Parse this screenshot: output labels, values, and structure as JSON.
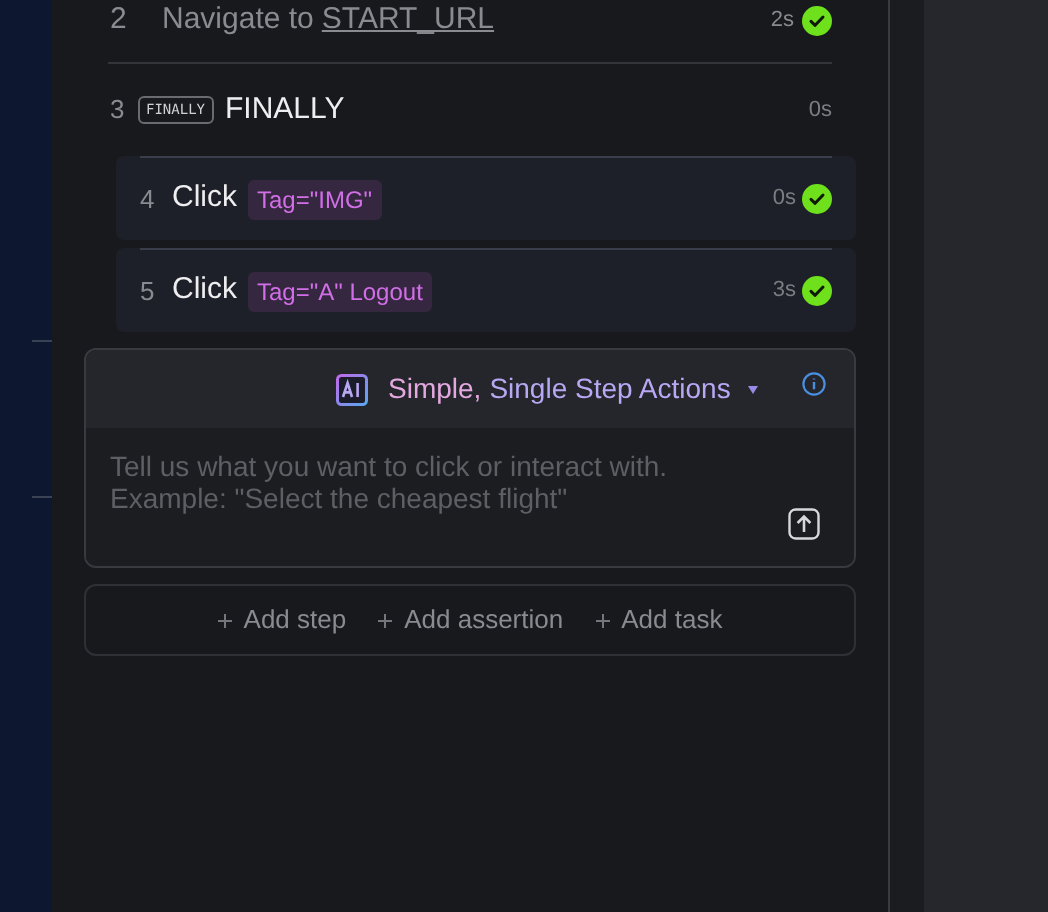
{
  "previous_step": {
    "number": "2",
    "text": "Navigate to",
    "link": "START_URL",
    "time": "2s",
    "passed": true
  },
  "finally_step": {
    "number": "3",
    "badge": "FINALLY",
    "title": "FINALLY",
    "time": "0s"
  },
  "child_steps": [
    {
      "number": "4",
      "action": "Click",
      "target": "Tag=\"IMG\"",
      "time": "0s",
      "passed": true
    },
    {
      "number": "5",
      "action": "Click",
      "target": "Tag=\"A\" Logout",
      "time": "3s",
      "passed": true
    }
  ],
  "prompt": {
    "mode_parts": [
      "Simple,",
      "Single Step Actions"
    ],
    "placeholder": "Tell us what you want to click or interact with.\nExample: \"Select the cheapest flight\""
  },
  "actions": [
    "Add step",
    "Add assertion",
    "Add task"
  ]
}
